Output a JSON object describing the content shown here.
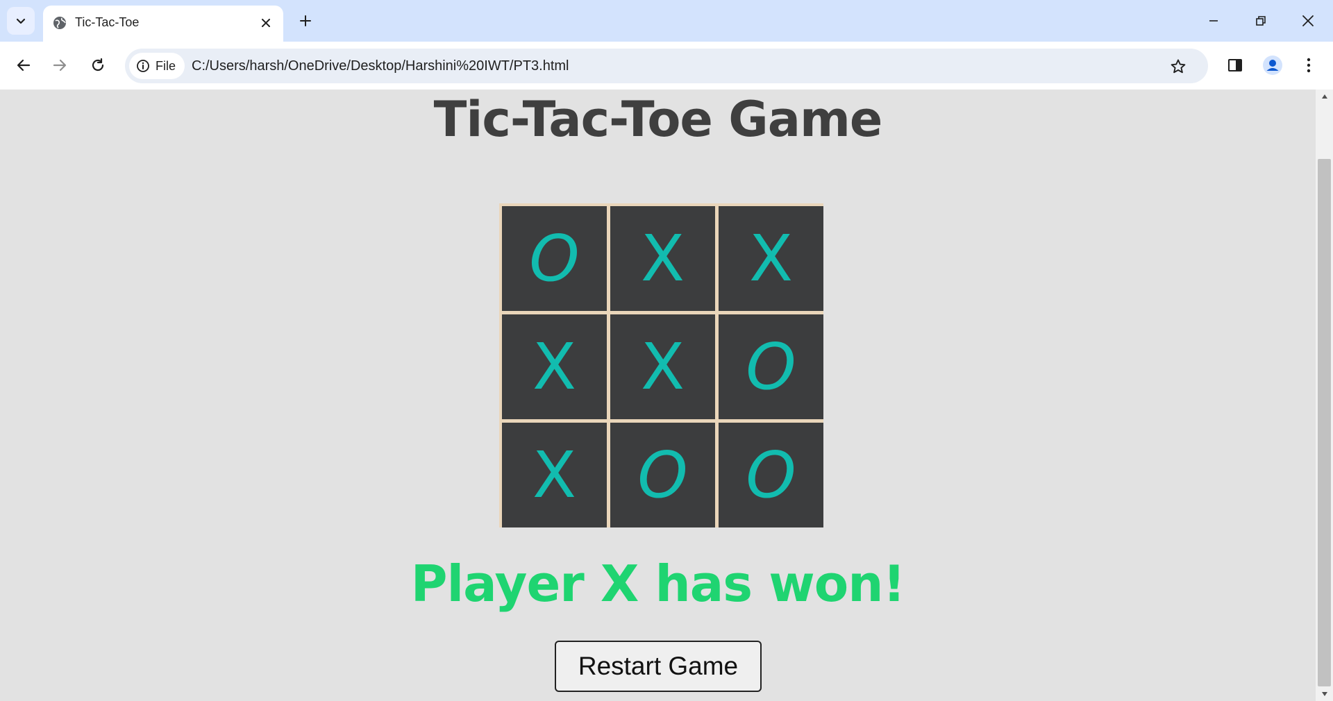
{
  "browser": {
    "tab": {
      "title": "Tic-Tac-Toe",
      "favicon": "globe-icon"
    },
    "address_bar": {
      "site_chip_label": "File",
      "url": "C:/Users/harsh/OneDrive/Desktop/Harshini%20IWT/PT3.html"
    }
  },
  "page": {
    "title": "Tic-Tac-Toe Game",
    "board": [
      [
        "O",
        "X",
        "X"
      ],
      [
        "X",
        "X",
        "O"
      ],
      [
        "X",
        "O",
        "O"
      ]
    ],
    "status": "Player X has won!",
    "restart_label": "Restart Game"
  },
  "colors": {
    "page_bg": "#e2e2e2",
    "cell_bg": "#3c3d3e",
    "mark": "#12bcaf",
    "board_gap": "#ead6ba",
    "status": "#1fd471",
    "title": "#3f3f3f"
  }
}
